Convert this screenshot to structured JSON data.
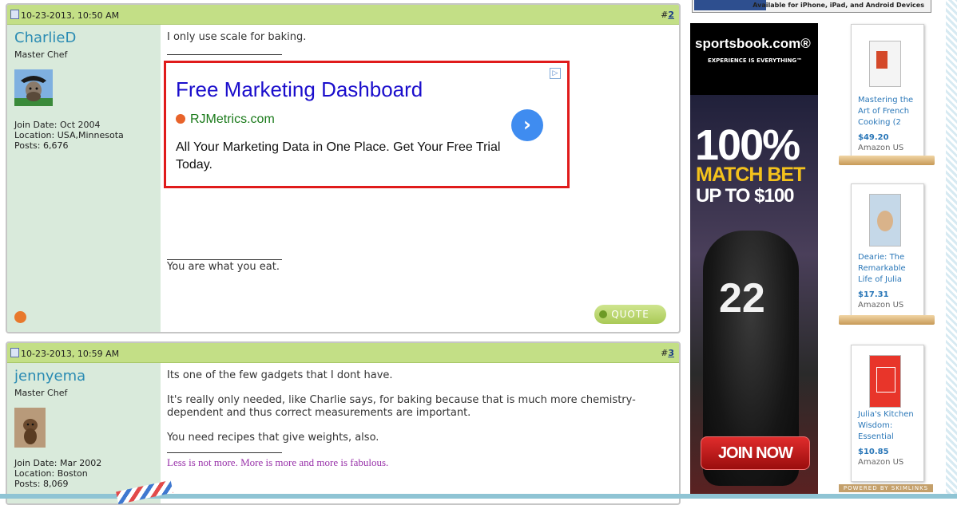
{
  "post1": {
    "date": "10-23-2013, 10:50 AM",
    "number_prefix": "#",
    "number": "2",
    "username": "CharlieD",
    "usertitle": "Master Chef",
    "join_date": "Join Date: Oct 2004",
    "location": "Location: USA,Minnesota",
    "posts": "Posts: 6,676",
    "message": "I only use scale for baking.",
    "signature": "You are what you eat.",
    "quote_label": "QUOTE",
    "online_status_color": "#e8792c"
  },
  "ad": {
    "title": "Free Marketing Dashboard",
    "url": "RJMetrics.com",
    "description": "All Your Marketing Data in One Place. Get Your Free Trial Today.",
    "arrow": "›",
    "border_color": "#e01b1b"
  },
  "post2": {
    "date": "10-23-2013, 10:59 AM",
    "number_prefix": "#",
    "number": "3",
    "username": "jennyema",
    "usertitle": "Master Chef",
    "join_date": "Join Date: Mar 2002",
    "location": "Location: Boston",
    "posts": "Posts: 8,069",
    "paragraphs": [
      "Its one of the few gadgets that I dont have.",
      "It's really only needed, like Charlie says, for baking because that is much more chemistry-dependent and thus correct measurements are important.",
      "You need recipes that give weights, also."
    ],
    "signature": "Less is not more. More is more and more is fabulous."
  },
  "top_ad": {
    "text": "Available for iPhone, iPad, and Android Devices"
  },
  "sportsbook": {
    "logo": "sportsbook.com®",
    "tagline": "EXPERIENCE IS EVERYTHING™",
    "headline": "100%",
    "match": "MATCH BET",
    "upto": "UP TO $100",
    "jersey": "22",
    "join": "JOIN NOW"
  },
  "books": [
    {
      "title": "Mastering the Art of French Cooking (2",
      "price": "$49.20",
      "store": "Amazon US"
    },
    {
      "title": "Dearie: The Remarkable Life of Julia",
      "price": "$17.31",
      "store": "Amazon US"
    },
    {
      "title": "Julia's Kitchen Wisdom: Essential",
      "price": "$10.85",
      "store": "Amazon US"
    }
  ],
  "powered_by": "POWERED BY SKIMLINKS",
  "colors": {
    "post_header": "#c3df86",
    "user_panel": "#d9eadb",
    "username": "#2a8bb3",
    "link": "#1a3c88"
  }
}
